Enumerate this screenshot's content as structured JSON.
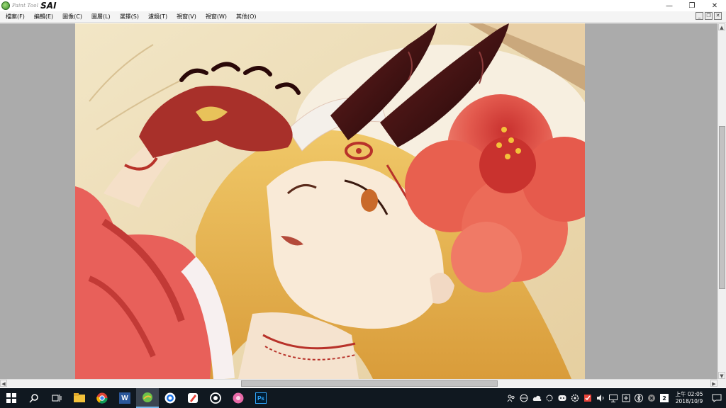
{
  "app": {
    "logo_small": "Paint Tool",
    "logo_big": "SAI",
    "window_controls": {
      "minimize": "—",
      "maximize": "❐",
      "close": "✕"
    }
  },
  "menu": {
    "items": [
      {
        "label": "檔案(F)"
      },
      {
        "label": "編輯(E)"
      },
      {
        "label": "圖像(C)"
      },
      {
        "label": "圖層(L)"
      },
      {
        "label": "選擇(S)"
      },
      {
        "label": "濾鏡(T)"
      },
      {
        "label": "視窗(V)"
      },
      {
        "label": "視窗(W)"
      },
      {
        "label": "其他(O)"
      }
    ],
    "mdi_controls": {
      "minimize": "_",
      "restore": "❐",
      "close": "✕"
    }
  },
  "scrollbars": {
    "up": "▲",
    "down": "▼",
    "left": "◀",
    "right": "▶"
  },
  "taskbar": {
    "apps": [
      {
        "icon": "windows-start-icon"
      },
      {
        "icon": "search-icon"
      },
      {
        "icon": "task-view-icon"
      },
      {
        "icon": "file-explorer-icon"
      },
      {
        "icon": "chrome-icon"
      },
      {
        "icon": "word-icon",
        "label": "W"
      },
      {
        "icon": "paint-tool-sai-icon"
      },
      {
        "icon": "chrome-alt-icon"
      },
      {
        "icon": "pen-app-icon"
      },
      {
        "icon": "circle-app-icon"
      },
      {
        "icon": "pink-app-icon"
      },
      {
        "icon": "photoshop-icon",
        "label": "Ps"
      }
    ],
    "tray": {
      "clock_line1": "上午 02:05",
      "clock_line2": "2018/10/9",
      "badge": "2"
    }
  },
  "colors": {
    "workspace_bg": "#ababab",
    "taskbar_bg": "#101820",
    "hibiscus": "#d9433c",
    "horn": "#3a1010",
    "hair": "#e9b54a"
  }
}
